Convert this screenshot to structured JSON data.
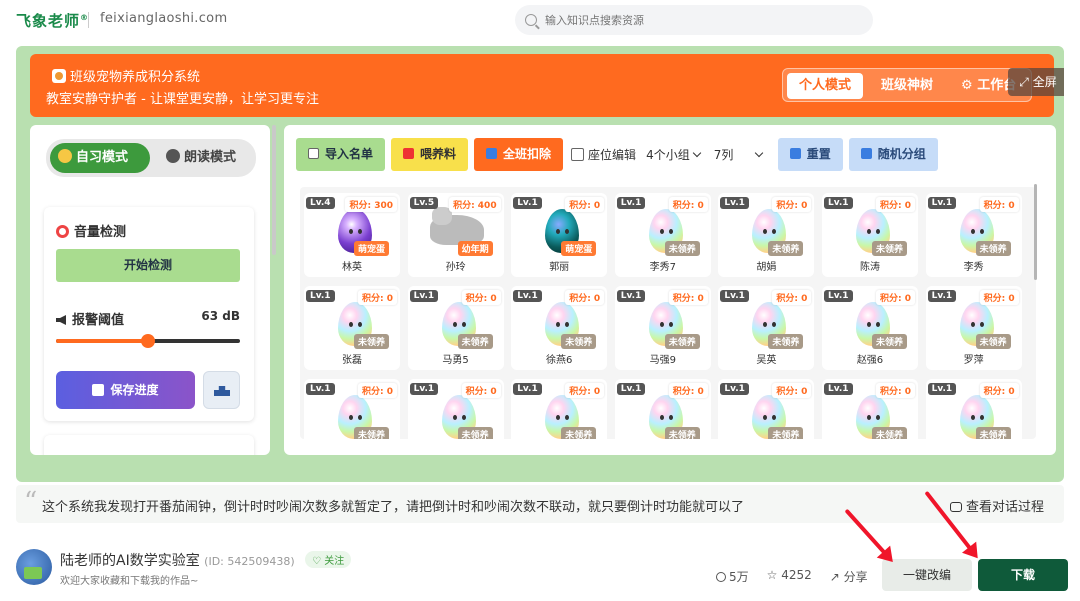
{
  "site": {
    "logo": "飞象老师",
    "domain": "feixianglaoshi.com",
    "search_placeholder": "输入知识点搜索资源"
  },
  "app": {
    "title": "班级宠物养成积分系统",
    "subtitle": "教室安静守护者 - 让课堂更安静，让学习更专注",
    "modes": [
      "个人模式",
      "班级神树",
      "工作台"
    ],
    "fullscreen": "全屏"
  },
  "sidebar": {
    "mode_on": "自习模式",
    "mode_off": "朗读模式",
    "volume_title": "音量检测",
    "start_btn": "开始检测",
    "threshold_label": "报警阈值",
    "threshold_value": "63 dB",
    "threshold_level": 0.5,
    "save_btn": "保存进度"
  },
  "toolbar": {
    "import": "导入名单",
    "feed": "喂养料",
    "deduct": "全班扣除",
    "seat_edit": "座位编辑",
    "groups": "4个小组",
    "columns": "7列",
    "reset": "重置",
    "random": "随机分组"
  },
  "pets": [
    {
      "lv": "Lv.4",
      "pts": "积分: 300",
      "tag": "萌宠蛋",
      "name": "林英",
      "type": "purple"
    },
    {
      "lv": "Lv.5",
      "pts": "积分: 400",
      "tag": "幼年期",
      "name": "孙玲",
      "type": "cat"
    },
    {
      "lv": "Lv.1",
      "pts": "积分: 0",
      "tag": "萌宠蛋",
      "name": "郭丽",
      "type": "dark"
    },
    {
      "lv": "Lv.1",
      "pts": "积分: 0",
      "tag": "未领养",
      "name": "李秀7",
      "type": "egg"
    },
    {
      "lv": "Lv.1",
      "pts": "积分: 0",
      "tag": "未领养",
      "name": "胡娟",
      "type": "egg"
    },
    {
      "lv": "Lv.1",
      "pts": "积分: 0",
      "tag": "未领养",
      "name": "陈涛",
      "type": "egg"
    },
    {
      "lv": "Lv.1",
      "pts": "积分: 0",
      "tag": "未领养",
      "name": "李秀",
      "type": "egg"
    },
    {
      "lv": "Lv.1",
      "pts": "积分: 0",
      "tag": "未领养",
      "name": "张磊",
      "type": "egg"
    },
    {
      "lv": "Lv.1",
      "pts": "积分: 0",
      "tag": "未领养",
      "name": "马勇5",
      "type": "egg"
    },
    {
      "lv": "Lv.1",
      "pts": "积分: 0",
      "tag": "未领养",
      "name": "徐燕6",
      "type": "egg"
    },
    {
      "lv": "Lv.1",
      "pts": "积分: 0",
      "tag": "未领养",
      "name": "马强9",
      "type": "egg"
    },
    {
      "lv": "Lv.1",
      "pts": "积分: 0",
      "tag": "未领养",
      "name": "吴英",
      "type": "egg"
    },
    {
      "lv": "Lv.1",
      "pts": "积分: 0",
      "tag": "未领养",
      "name": "赵强6",
      "type": "egg"
    },
    {
      "lv": "Lv.1",
      "pts": "积分: 0",
      "tag": "未领养",
      "name": "罗萍",
      "type": "egg"
    },
    {
      "lv": "Lv.1",
      "pts": "积分: 0",
      "tag": "未领养",
      "name": "",
      "type": "egg"
    },
    {
      "lv": "Lv.1",
      "pts": "积分: 0",
      "tag": "未领养",
      "name": "",
      "type": "egg"
    },
    {
      "lv": "Lv.1",
      "pts": "积分: 0",
      "tag": "未领养",
      "name": "",
      "type": "egg"
    },
    {
      "lv": "Lv.1",
      "pts": "积分: 0",
      "tag": "未领养",
      "name": "",
      "type": "egg"
    },
    {
      "lv": "Lv.1",
      "pts": "积分: 0",
      "tag": "未领养",
      "name": "",
      "type": "egg"
    },
    {
      "lv": "Lv.1",
      "pts": "积分: 0",
      "tag": "未领养",
      "name": "",
      "type": "egg"
    },
    {
      "lv": "Lv.1",
      "pts": "积分: 0",
      "tag": "未领养",
      "name": "",
      "type": "egg"
    }
  ],
  "comment": {
    "text": "这个系统我发现打开番茄闹钟，倒计时时吵闹次数多就暂定了，请把倒计时和吵闹次数不联动，就只要倒计时功能就可以了",
    "view_link": "查看对话过程"
  },
  "footer": {
    "author": "陆老师的AI数学实验室",
    "uid": "(ID: 542509438)",
    "follow": "关注",
    "tagline": "欢迎大家收藏和下载我的作品~",
    "views": "5万",
    "stars": "4252",
    "share": "分享",
    "edit_btn": "一键改编",
    "download_btn": "下载"
  }
}
